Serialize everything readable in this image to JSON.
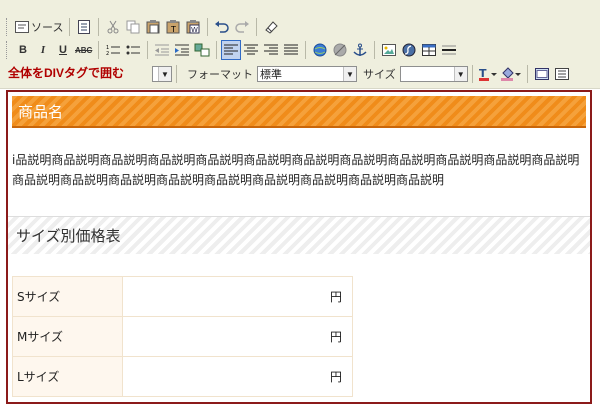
{
  "toolbar": {
    "source_label": "ソース",
    "bold": "B",
    "italic": "I",
    "underline": "U",
    "strike": "ABC"
  },
  "format_bar": {
    "tooltip": "全体をDIVタグで囲む",
    "format_label": "フォーマット",
    "format_value": "標準",
    "size_label": "サイズ",
    "size_value": ""
  },
  "content": {
    "title": "商品名",
    "description": "i品説明商品説明商品説明商品説明商品説明商品説明商品説明商品説明商品説明商品説明商品説明商品説明商品説明商品説明商品説明商品説明商品説明商品説明商品説明商品説明商品説明",
    "section_title": "サイズ別価格表",
    "rows": [
      {
        "size": "Sサイズ",
        "price": "円"
      },
      {
        "size": "Mサイズ",
        "price": "円"
      },
      {
        "size": "Lサイズ",
        "price": "円"
      }
    ]
  },
  "colors": {
    "title_bar": "#f08c1a",
    "frame_border": "#8b1a1a",
    "tooltip_text": "#b00000"
  }
}
